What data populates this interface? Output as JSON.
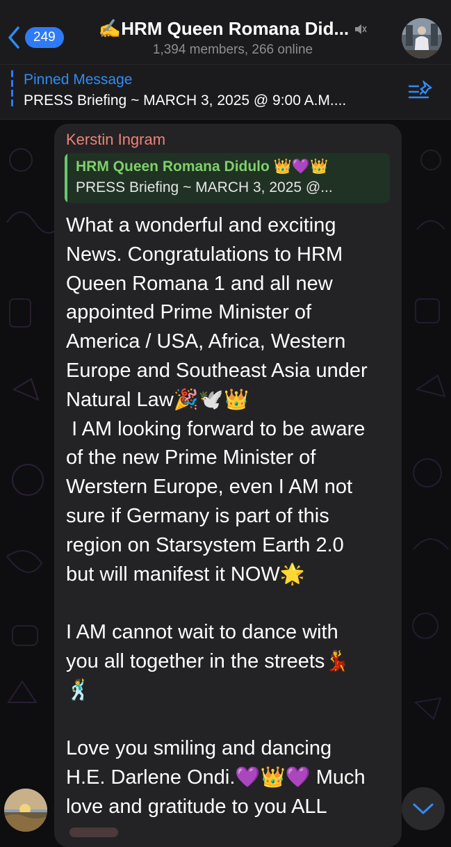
{
  "header": {
    "back_count": "249",
    "title": "✍️HRM Queen Romana Did...",
    "subtitle": "1,394 members, 266 online"
  },
  "pinned": {
    "label": "Pinned Message",
    "text": "PRESS Briefing ~ MARCH 3, 2025 @ 9:00 A.M...."
  },
  "message": {
    "sender": "Kerstin Ingram",
    "reply_name": "HRM Queen Romana Didulo 👑💜👑",
    "reply_text": "PRESS Briefing ~ MARCH 3, 2025 @...",
    "body": "What a wonderful and exciting\nNews. Congratulations to HRM\nQueen Romana 1 and all new\nappointed Prime Minister of\nAmerica / USA, Africa, Western\nEurope and Southeast Asia under\nNatural Law🎉🕊️👑\n I AM looking forward to be aware\nof the new Prime Minister of\nWerstern Europe, even I AM not\nsure if Germany is part of this\nregion on Starsystem Earth 2.0\nbut will manifest it NOW🌟\n\nI AM cannot wait to dance with\nyou all together in the streets💃\n🕺\n\nLove you smiling and dancing\nH.E. Darlene Ondi.💜👑💜 Much\nlove and gratitude to you ALL"
  },
  "colors": {
    "accent": "#2f7bf5",
    "sender": "#ee8376",
    "reply_name": "#7fd06a",
    "bubble": "#232325"
  },
  "icons": {
    "back": "chevron-left-icon",
    "mute": "muted-speaker-icon",
    "pinned_list": "pin-list-icon",
    "scroll": "chevron-down-icon"
  }
}
